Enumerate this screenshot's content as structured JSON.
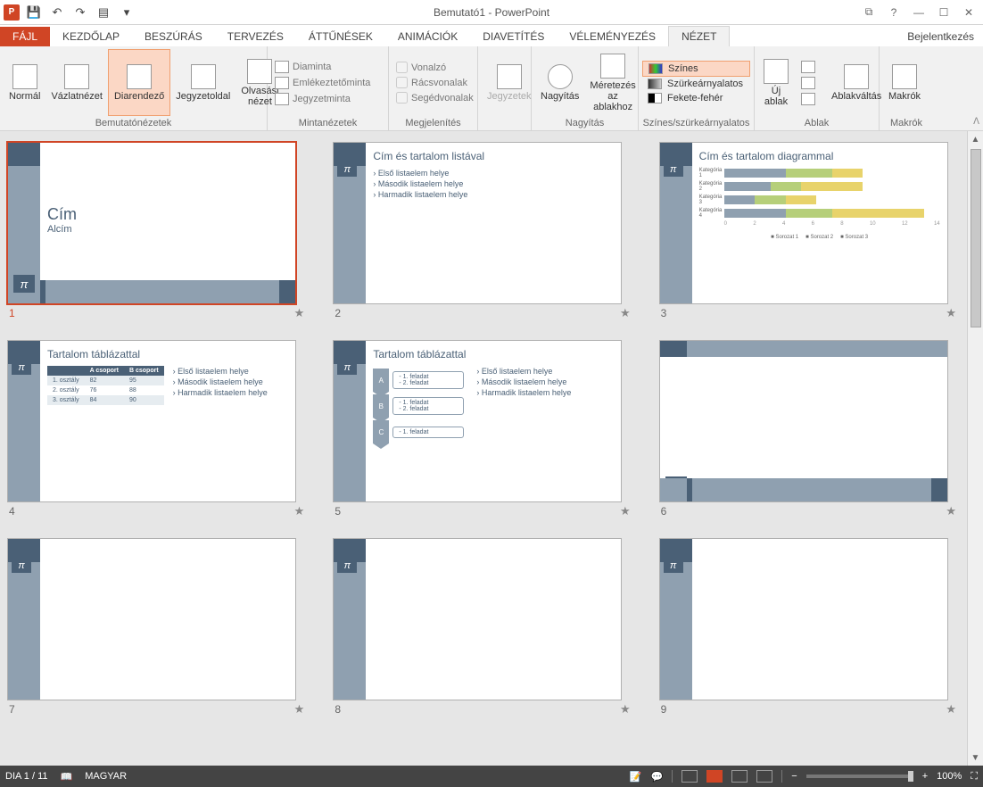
{
  "app": {
    "title": "Bemutató1 - PowerPoint",
    "signin": "Bejelentkezés"
  },
  "qat": {
    "save": "💾",
    "undo": "↶",
    "redo": "↷",
    "start": "▤"
  },
  "tabs": {
    "file": "FÁJL",
    "items": [
      "KEZDŐLAP",
      "BESZÚRÁS",
      "TERVEZÉS",
      "ÁTTŰNÉSEK",
      "ANIMÁCIÓK",
      "DIAVETÍTÉS",
      "VÉLEMÉNYEZÉS",
      "NÉZET"
    ],
    "active": "NÉZET"
  },
  "ribbon": {
    "g1": {
      "label": "Bemutatónézetek",
      "normal": "Normál",
      "outline": "Vázlatnézet",
      "sorter": "Diarendező",
      "notes": "Jegyzetoldal",
      "reading": "Olvasási\nnézet"
    },
    "g2": {
      "label": "Mintanézetek",
      "diaminta": "Diaminta",
      "emlekezteto": "Emlékeztetőminta",
      "jegyzetminta": "Jegyzetminta"
    },
    "g3": {
      "label": "Megjelenítés",
      "ruler": "Vonalzó",
      "grid": "Rácsvonalak",
      "guides": "Segédvonalak"
    },
    "g4": {
      "label": " ",
      "notes_btn": "Jegyzetek"
    },
    "g5": {
      "label": "Nagyítás",
      "zoom": "Nagyítás",
      "fit": "Méretezés\naz ablakhoz"
    },
    "g6": {
      "label": "Színes/szürkeárnyalatos",
      "color": "Színes",
      "gray": "Szürkeárnyalatos",
      "bw": "Fekete-fehér"
    },
    "g7": {
      "label": "Ablak",
      "new": "Új\nablak",
      "switch": "Ablakváltás"
    },
    "g8": {
      "label": "Makrók",
      "macros": "Makrók"
    }
  },
  "slides": [
    {
      "n": "1",
      "kind": "title",
      "title": "Cím",
      "sub": "Alcím",
      "selected": true
    },
    {
      "n": "2",
      "kind": "list",
      "h": "Cím és tartalom listával",
      "items": [
        "Első listaelem helye",
        "Második listaelem helye",
        "Harmadik listaelem helye"
      ]
    },
    {
      "n": "3",
      "kind": "chart",
      "h": "Cím és tartalom diagrammal"
    },
    {
      "n": "4",
      "kind": "table",
      "h": "Tartalom táblázattal",
      "items": [
        "Első listaelem helye",
        "Második listaelem helye",
        "Harmadik listaelem helye"
      ]
    },
    {
      "n": "5",
      "kind": "chevron",
      "h": "Tartalom táblázattal",
      "items": [
        "Első listaelem helye",
        "Második listaelem helye",
        "Harmadik listaelem helye"
      ]
    },
    {
      "n": "6",
      "kind": "blank-deco"
    },
    {
      "n": "7",
      "kind": "blank"
    },
    {
      "n": "8",
      "kind": "blank"
    },
    {
      "n": "9",
      "kind": "blank"
    }
  ],
  "chart_data": {
    "type": "bar",
    "orientation": "horizontal",
    "stacked": true,
    "categories": [
      "Kategória 1",
      "Kategória 2",
      "Kategória 3",
      "Kategória 4"
    ],
    "series": [
      {
        "name": "Sorozat 1",
        "color": "#8fa0b0",
        "values": [
          4,
          3,
          2,
          4
        ]
      },
      {
        "name": "Sorozat 2",
        "color": "#b6cf7a",
        "values": [
          3,
          2,
          2,
          3
        ]
      },
      {
        "name": "Sorozat 3",
        "color": "#e8d36b",
        "values": [
          2,
          4,
          2,
          6
        ]
      }
    ],
    "xlim": [
      0,
      14
    ],
    "xticks": [
      0,
      2,
      4,
      6,
      8,
      10,
      12,
      14
    ],
    "legend_position": "bottom"
  },
  "table_data": {
    "headers": [
      "",
      "A csoport",
      "B csoport"
    ],
    "rows": [
      [
        "1. osztály",
        "82",
        "95"
      ],
      [
        "2. osztály",
        "76",
        "88"
      ],
      [
        "3. osztály",
        "84",
        "90"
      ]
    ]
  },
  "chevron_data": {
    "groups": [
      {
        "label": "A",
        "tasks": [
          "- 1. feladat",
          "- 2. feladat"
        ]
      },
      {
        "label": "B",
        "tasks": [
          "- 1. feladat",
          "- 2. feladat"
        ]
      },
      {
        "label": "C",
        "tasks": [
          "- 1. feladat"
        ]
      }
    ]
  },
  "status": {
    "slide": "DIA 1 / 11",
    "lang": "MAGYAR",
    "zoom": "100%"
  }
}
